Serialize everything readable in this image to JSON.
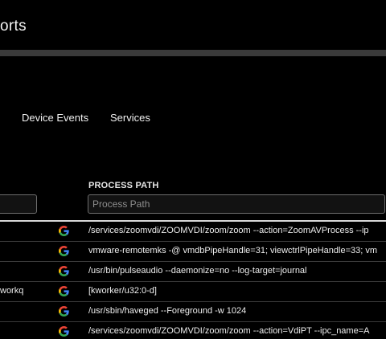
{
  "header": {
    "title": "orts"
  },
  "tabs": [
    {
      "label": "Device Events"
    },
    {
      "label": "Services"
    }
  ],
  "table": {
    "columns": {
      "process_path": {
        "header": "PROCESS PATH",
        "placeholder": "Process Path"
      },
      "name": {
        "placeholder": ""
      }
    },
    "rows": [
      {
        "name": "",
        "icon": "google-icon",
        "path": "/services/zoomvdi/ZOOMVDI/zoom/zoom --action=ZoomAVProcess --ip"
      },
      {
        "name": "",
        "icon": "google-icon",
        "path": "vmware-remotemks -@ vmdbPipeHandle=31; viewctrlPipeHandle=33; vm"
      },
      {
        "name": "",
        "icon": "google-icon",
        "path": "/usr/bin/pulseaudio --daemonize=no --log-target=journal"
      },
      {
        "name": "workq",
        "icon": "google-icon",
        "path": "[kworker/u32:0-d]"
      },
      {
        "name": "",
        "icon": "google-icon",
        "path": "/usr/sbin/haveged --Foreground -w 1024"
      },
      {
        "name": "",
        "icon": "google-icon",
        "path": "/services/zoomvdi/ZOOMVDI/zoom/zoom --action=VdiPT --ipc_name=A"
      }
    ]
  }
}
